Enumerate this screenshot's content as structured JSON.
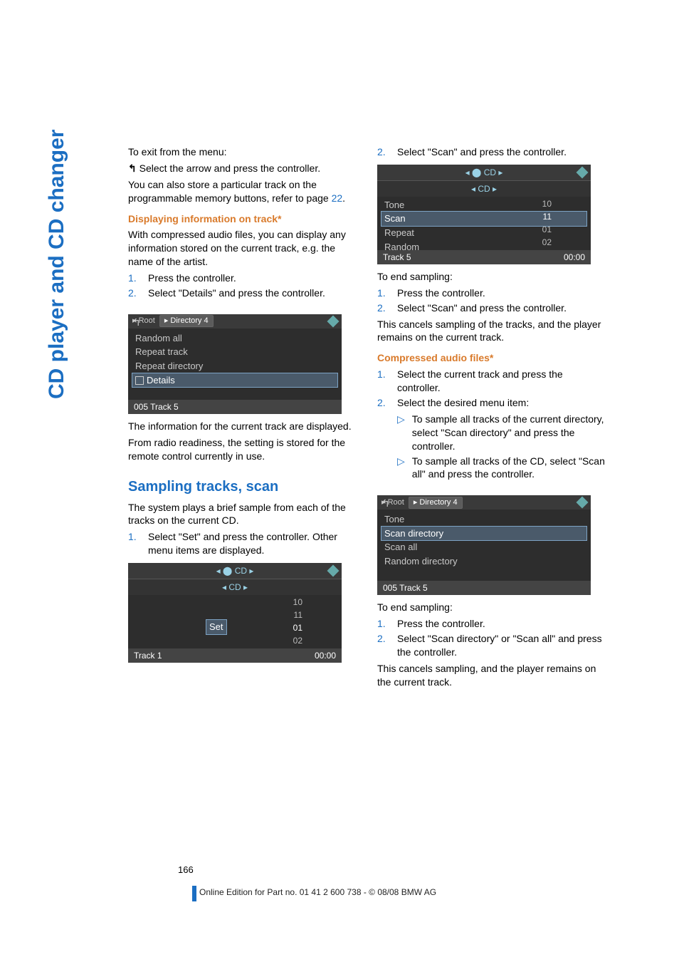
{
  "side_title": "CD player and CD changer",
  "page_number": "166",
  "footer": "Online Edition for Part no. 01 41 2 600 738 - © 08/08 BMW AG",
  "left": {
    "p1": "To exit from the menu:",
    "p2a": "       ",
    "p2b": "Select the arrow and press the controller.",
    "p3a": "You can also store a particular track on the programmable memory buttons, refer to page ",
    "p3b": "22",
    "p3c": ".",
    "h1": "Displaying information on track*",
    "p4": "With compressed audio files, you can display any information stored on the current track, e.g. the name of the artist.",
    "li1": "Press the controller.",
    "li2": "Select \"Details\" and press the controller.",
    "ss1": {
      "tab1": "Root",
      "tab2": "Directory 4",
      "r1": "Random all",
      "r2": "Repeat track",
      "r3": "Repeat directory",
      "r4": "Details",
      "footer": "005 Track 5"
    },
    "p5": "The information for the current track are displayed.",
    "p6": "From radio readiness, the setting is stored for the remote control currently in use.",
    "h2": "Sampling tracks, scan",
    "p7": "The system plays a brief sample from each of the tracks on the current CD.",
    "li3": "Select \"Set\" and press the controller. Other menu items are displayed.",
    "ss2": {
      "top": "CD",
      "sub": "CD",
      "sel": "Set",
      "n1": "10",
      "n2": "11",
      "n3": "01",
      "n4": "02",
      "footerL": "Track 1",
      "footerR": "00:00"
    }
  },
  "right": {
    "li1": "Select  \"Scan\" and press the controller.",
    "ss1": {
      "top": "CD",
      "sub": "CD",
      "r1": "Tone",
      "r2": "Scan",
      "r3": "Repeat",
      "r4": "Random",
      "n1": "10",
      "n2": "11",
      "n3": "01",
      "n4": "02",
      "footerL": "Track 5",
      "footerR": "00:00"
    },
    "p1": "To end sampling:",
    "li2": "Press the controller.",
    "li3": "Select \"Scan\" and press the controller.",
    "p2": "This cancels sampling of the tracks, and the player remains on the current track.",
    "h1": "Compressed audio files*",
    "li4": "Select the current track and press the controller.",
    "li5": "Select the desired menu item:",
    "s1": "To sample all tracks of the current directory, select \"Scan directory\" and press the controller.",
    "s2": "To sample all tracks of the CD, select \"Scan all\" and press the controller.",
    "ss2": {
      "tab1": "Root",
      "tab2": "Directory 4",
      "r1": "Tone",
      "r2": "Scan directory",
      "r3": "Scan all",
      "r4": "Random directory",
      "footer": "005 Track 5"
    },
    "p3": "To end sampling:",
    "li6": "Press the controller.",
    "li7": "Select \"Scan directory\" or \"Scan all\" and press the controller.",
    "p4": "This cancels sampling, and the player remains on the current track."
  }
}
